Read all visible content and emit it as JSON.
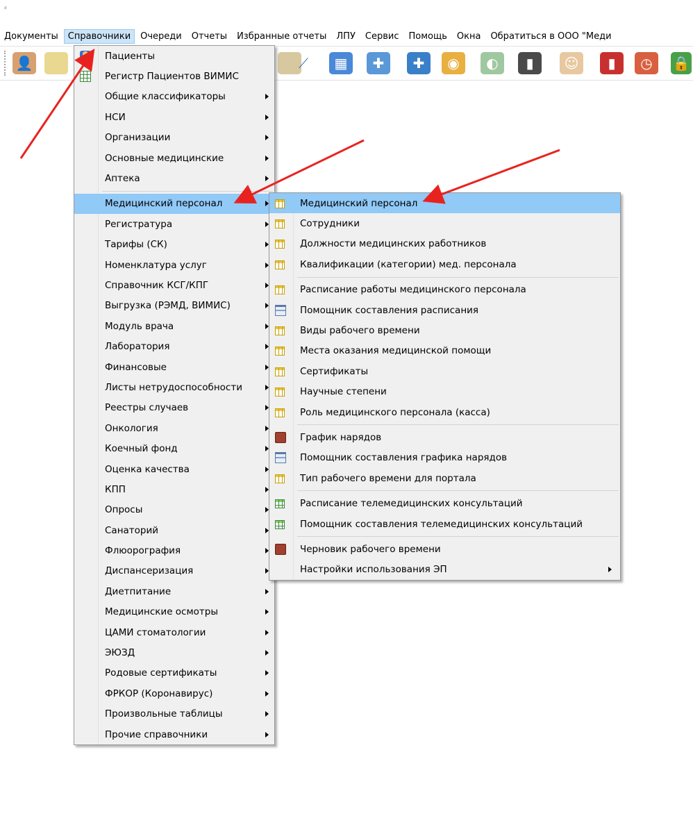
{
  "menubar": {
    "items": [
      "Документы",
      "Справочники",
      "Очереди",
      "Отчеты",
      "Избранные отчеты",
      "ЛПУ",
      "Сервис",
      "Помощь",
      "Окна",
      "Обратиться в ООО \"Меди"
    ]
  },
  "toolbar": {
    "icons": [
      "doctor-icon",
      "notebook-icon",
      "syringe-icon",
      "calendar-icon",
      "medicine-icon",
      "first-aid-icon",
      "basket-icon",
      "pills-icon",
      "barcode-scanner-icon",
      "nurse-icon",
      "red-book-icon",
      "schedule-icon",
      "lock-icon"
    ]
  },
  "menu1": {
    "items": [
      {
        "label": "Пациенты",
        "icon": "patient-icon",
        "submenu": false
      },
      {
        "label": "Регистр Пациентов ВИМИС",
        "icon": "register-icon",
        "submenu": false
      },
      {
        "label": "Общие классификаторы",
        "submenu": true
      },
      {
        "label": "НСИ",
        "submenu": true
      },
      {
        "label": "Организации",
        "submenu": true
      },
      {
        "label": "Основные медицинские",
        "submenu": true
      },
      {
        "label": "Аптека",
        "submenu": true
      },
      {
        "label": "Медицинский персонал",
        "submenu": true,
        "highlighted": true
      },
      {
        "label": "Регистратура",
        "submenu": true
      },
      {
        "label": "Тарифы (СК)",
        "submenu": true
      },
      {
        "label": "Номенклатура услуг",
        "submenu": true
      },
      {
        "label": "Справочник КСГ/КПГ",
        "submenu": true
      },
      {
        "label": "Выгрузка (РЭМД, ВИМИС)",
        "submenu": true
      },
      {
        "label": "Модуль врача",
        "submenu": true
      },
      {
        "label": "Лаборатория",
        "submenu": true
      },
      {
        "label": "Финансовые",
        "submenu": true
      },
      {
        "label": "Листы нетрудоспособности",
        "submenu": true
      },
      {
        "label": "Реестры случаев",
        "submenu": true
      },
      {
        "label": "Онкология",
        "submenu": true
      },
      {
        "label": "Коечный фонд",
        "submenu": true
      },
      {
        "label": "Оценка качества",
        "submenu": true
      },
      {
        "label": "КПП",
        "submenu": true
      },
      {
        "label": "Опросы",
        "submenu": true
      },
      {
        "label": "Санаторий",
        "submenu": true
      },
      {
        "label": "Флюорография",
        "submenu": true
      },
      {
        "label": "Диспансеризация",
        "submenu": true
      },
      {
        "label": "Диетпитание",
        "submenu": true
      },
      {
        "label": "Медицинские осмотры",
        "submenu": true
      },
      {
        "label": "ЦАМИ стоматологии",
        "submenu": true
      },
      {
        "label": "ЭЮЗД",
        "submenu": true
      },
      {
        "label": "Родовые сертификаты",
        "submenu": true
      },
      {
        "label": "ФРКОР (Коронавирус)",
        "submenu": true
      },
      {
        "label": "Произвольные таблицы",
        "submenu": true
      },
      {
        "label": "Прочие справочники",
        "submenu": true
      }
    ]
  },
  "menu2": {
    "items": [
      {
        "label": "Медицинский персонал",
        "icon": "grid",
        "highlighted": true
      },
      {
        "label": "Сотрудники",
        "icon": "grid"
      },
      {
        "label": "Должности медицинских работников",
        "icon": "grid"
      },
      {
        "label": "Квалификации (категории) мед. персонала",
        "icon": "grid"
      },
      {
        "label": "Расписание работы медицинского персонала",
        "icon": "grid"
      },
      {
        "label": "Помощник составления расписания",
        "icon": "helper"
      },
      {
        "label": "Виды рабочего времени",
        "icon": "grid"
      },
      {
        "label": "Места оказания медицинской помощи",
        "icon": "grid"
      },
      {
        "label": "Сертификаты",
        "icon": "grid"
      },
      {
        "label": "Научные степени",
        "icon": "grid"
      },
      {
        "label": "Роль медицинского персонала (касса)",
        "icon": "grid"
      },
      {
        "label": "График нарядов",
        "icon": "book"
      },
      {
        "label": "Помощник составления графика нарядов",
        "icon": "helper"
      },
      {
        "label": "Тип рабочего времени для портала",
        "icon": "grid"
      },
      {
        "label": "Расписание телемедицинских консультаций",
        "icon": "grid-green"
      },
      {
        "label": "Помощник составления телемедицинских консультаций",
        "icon": "grid-green"
      },
      {
        "label": "Черновик рабочего времени",
        "icon": "book"
      },
      {
        "label": "Настройки использования ЭП",
        "icon": "",
        "submenu": true
      }
    ]
  },
  "colors": {
    "highlight": "#91c9f7",
    "menu_bg": "#f0f0f0",
    "annotation_arrow": "#e8231f"
  }
}
